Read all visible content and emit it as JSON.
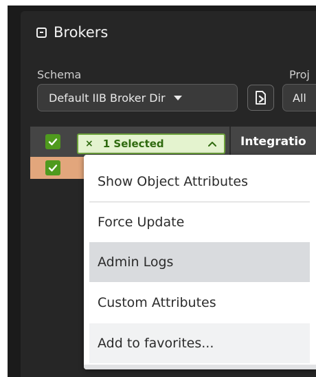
{
  "window": {
    "title": "Brokers"
  },
  "filters": {
    "schema_label": "Schema",
    "schema_value": "Default IIB Broker Dir",
    "project_label": "Proj",
    "project_value": "All"
  },
  "table": {
    "selection_chip": {
      "close_glyph": "×",
      "label": "1 Selected",
      "chevron": "^"
    },
    "column_title": "Integratio",
    "row_checked": true,
    "header_checked": true
  },
  "context_menu": {
    "items": [
      {
        "label": "Show Object Attributes"
      },
      {
        "label": "Force Update"
      },
      {
        "label": "Admin Logs"
      },
      {
        "label": "Custom Attributes"
      },
      {
        "label": "Add to favorites..."
      }
    ]
  },
  "icons": [
    "collapse-icon",
    "document-arrow-icon",
    "checkbox-checked-icon",
    "chevron-down-icon"
  ],
  "colors": {
    "accent_green": "#4f9a1e",
    "chip_bg": "#e4f3cf",
    "row_highlight": "#e2a67c",
    "menu_hover": "#d9dbde"
  }
}
